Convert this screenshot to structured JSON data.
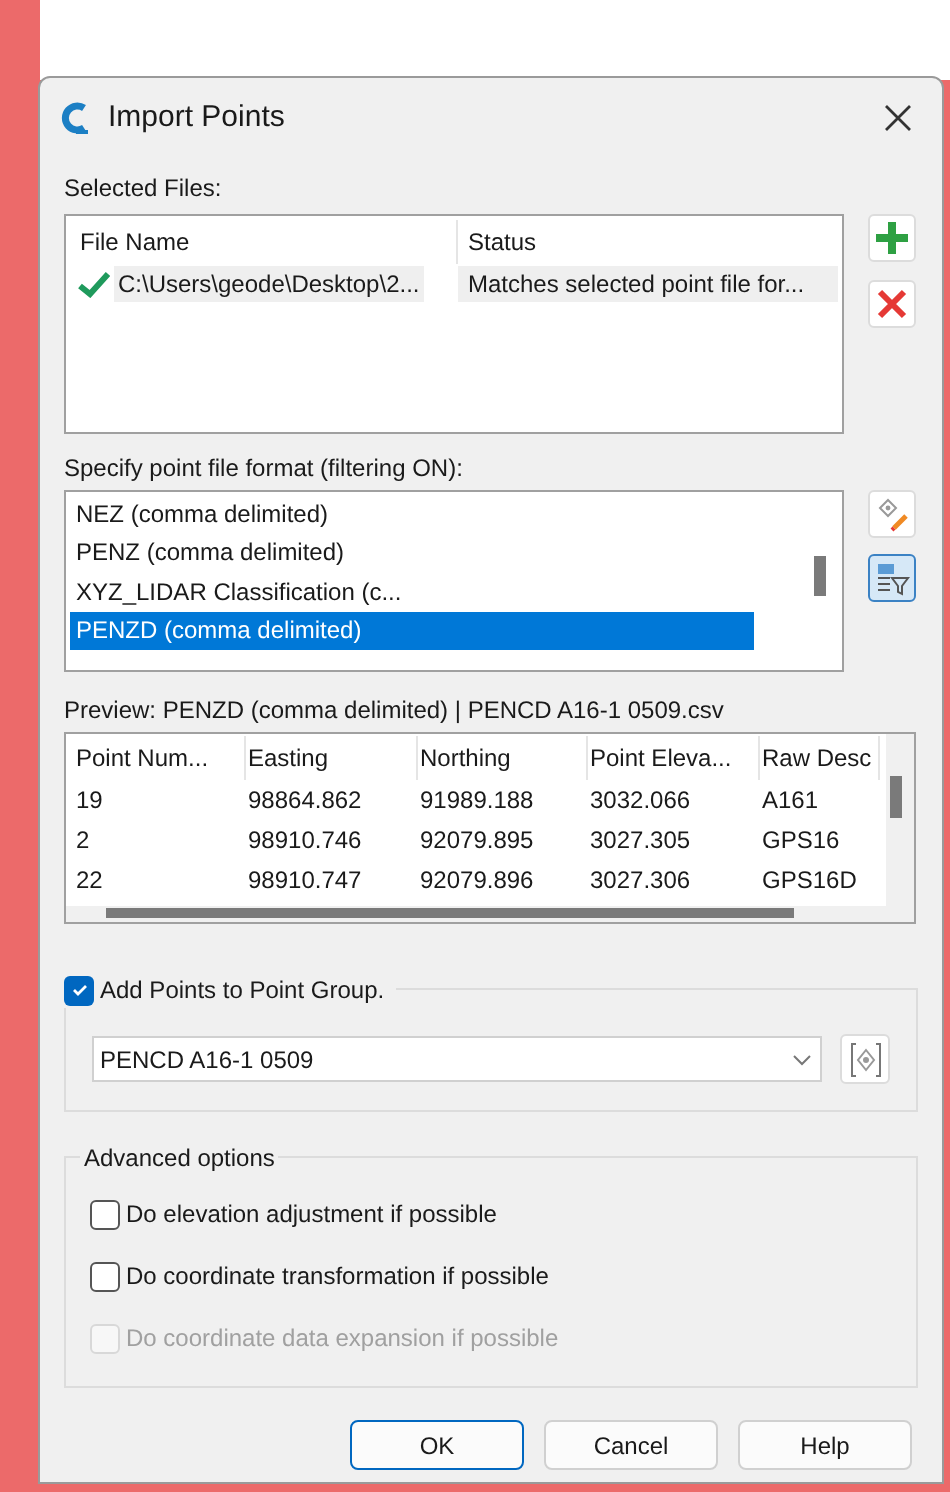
{
  "window": {
    "title": "Import Points"
  },
  "selected_files": {
    "label": "Selected Files:",
    "columns": [
      "File Name",
      "Status"
    ],
    "rows": [
      {
        "file_name": "C:\\Users\\geode\\Desktop\\2...",
        "status": "Matches selected point file for...",
        "valid": true
      }
    ]
  },
  "format": {
    "label": "Specify point file format (filtering ON):",
    "items": [
      {
        "label": "NEZ (comma delimited)",
        "selected": false
      },
      {
        "label": "PENZ (comma delimited)",
        "selected": false
      },
      {
        "label": "XYZ_LIDAR Classification (c...",
        "selected": false
      },
      {
        "label": "PENZD (comma delimited)",
        "selected": true
      }
    ]
  },
  "preview": {
    "label": "Preview: PENZD (comma delimited) | PENCD A16-1 0509.csv",
    "columns": [
      "Point Num...",
      "Easting",
      "Northing",
      "Point Eleva...",
      "Raw Desc"
    ],
    "rows": [
      [
        "19",
        "98864.862",
        "91989.188",
        "3032.066",
        "A161"
      ],
      [
        "2",
        "98910.746",
        "92079.895",
        "3027.305",
        "GPS16"
      ],
      [
        "22",
        "98910.747",
        "92079.896",
        "3027.306",
        "GPS16D"
      ]
    ]
  },
  "point_group": {
    "label": "Add Points to Point Group.",
    "checked": true,
    "value": "PENCD A16-1 0509"
  },
  "advanced": {
    "label": "Advanced options",
    "options": [
      {
        "label": "Do elevation adjustment if possible",
        "checked": false,
        "disabled": false
      },
      {
        "label": "Do coordinate transformation if possible",
        "checked": false,
        "disabled": false
      },
      {
        "label": "Do coordinate data expansion if possible",
        "checked": false,
        "disabled": true
      }
    ]
  },
  "buttons": [
    "OK",
    "Cancel",
    "Help"
  ]
}
